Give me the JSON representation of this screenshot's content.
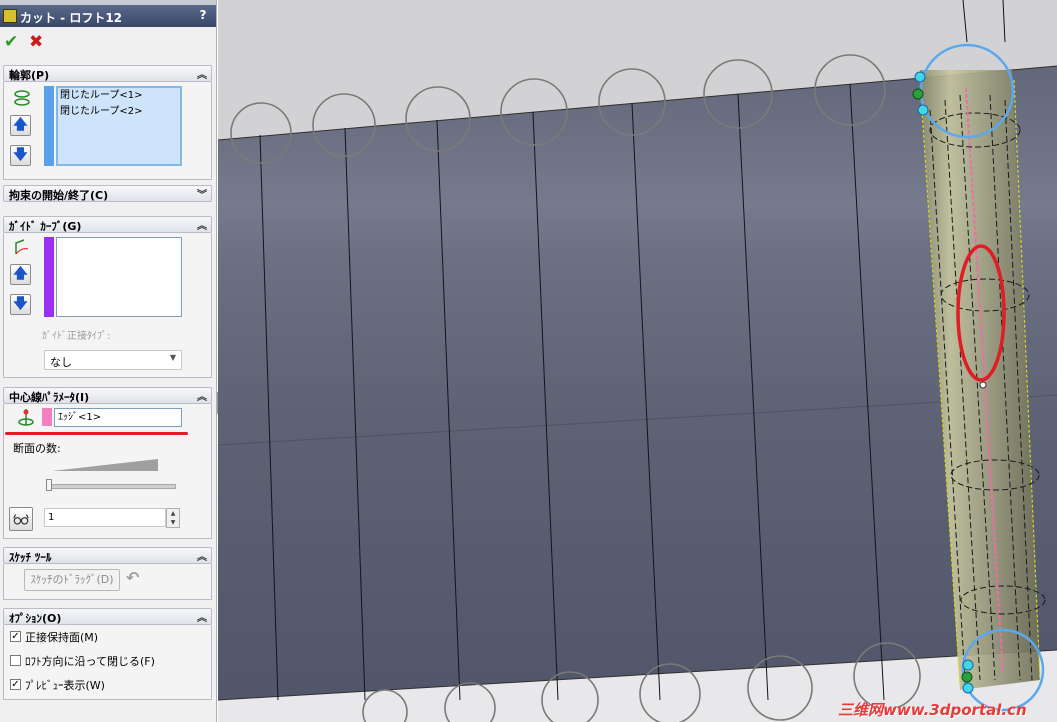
{
  "title": "カット - ロフト12",
  "help_label": "?",
  "ok_symbol": "✔",
  "cancel_symbol": "✖",
  "sections": {
    "profile": {
      "label": "輪郭(P)",
      "items": [
        "閉じたループ<1>",
        "閉じたループ<2>"
      ]
    },
    "start_end": {
      "label": "拘束の開始/終了(C)"
    },
    "guide": {
      "label": "ｶﾞｲﾄﾞ ｶｰﾌﾞ(G)",
      "tangent_label": "ｶﾞｲﾄﾞ正接ﾀｲﾌﾟ:",
      "tangent_value": "なし"
    },
    "centerline": {
      "label": "中心線ﾊﾟﾗﾒｰﾀ(I)",
      "edge_value": "ｴｯｼﾞ<1>",
      "sections_label": "断面の数:",
      "sections_value": "1",
      "slider_level": 0
    },
    "sketch_tools": {
      "label": "ｽｹｯﾁ ﾂｰﾙ",
      "drag_label": "ｽｹｯﾁのﾄﾞﾗｯｸﾞ(D)"
    },
    "options": {
      "label": "ｵﾌﾟｼｮﾝ(O)",
      "items": [
        {
          "label": "正接保持面(M)",
          "checked": true
        },
        {
          "label": "ﾛﾌﾄ方向に沿って閉じる(F)",
          "checked": false
        },
        {
          "label": "ﾌﾟﾚﾋﾞｭｰ表示(W)",
          "checked": true
        }
      ]
    }
  },
  "watermark": "三维网www.3dportal.cn",
  "colors": {
    "profile_bar": "#5aa0e8",
    "guide_bar": "#9b30f0",
    "center_bar": "#f080c0",
    "accent_red": "#e01c24"
  }
}
